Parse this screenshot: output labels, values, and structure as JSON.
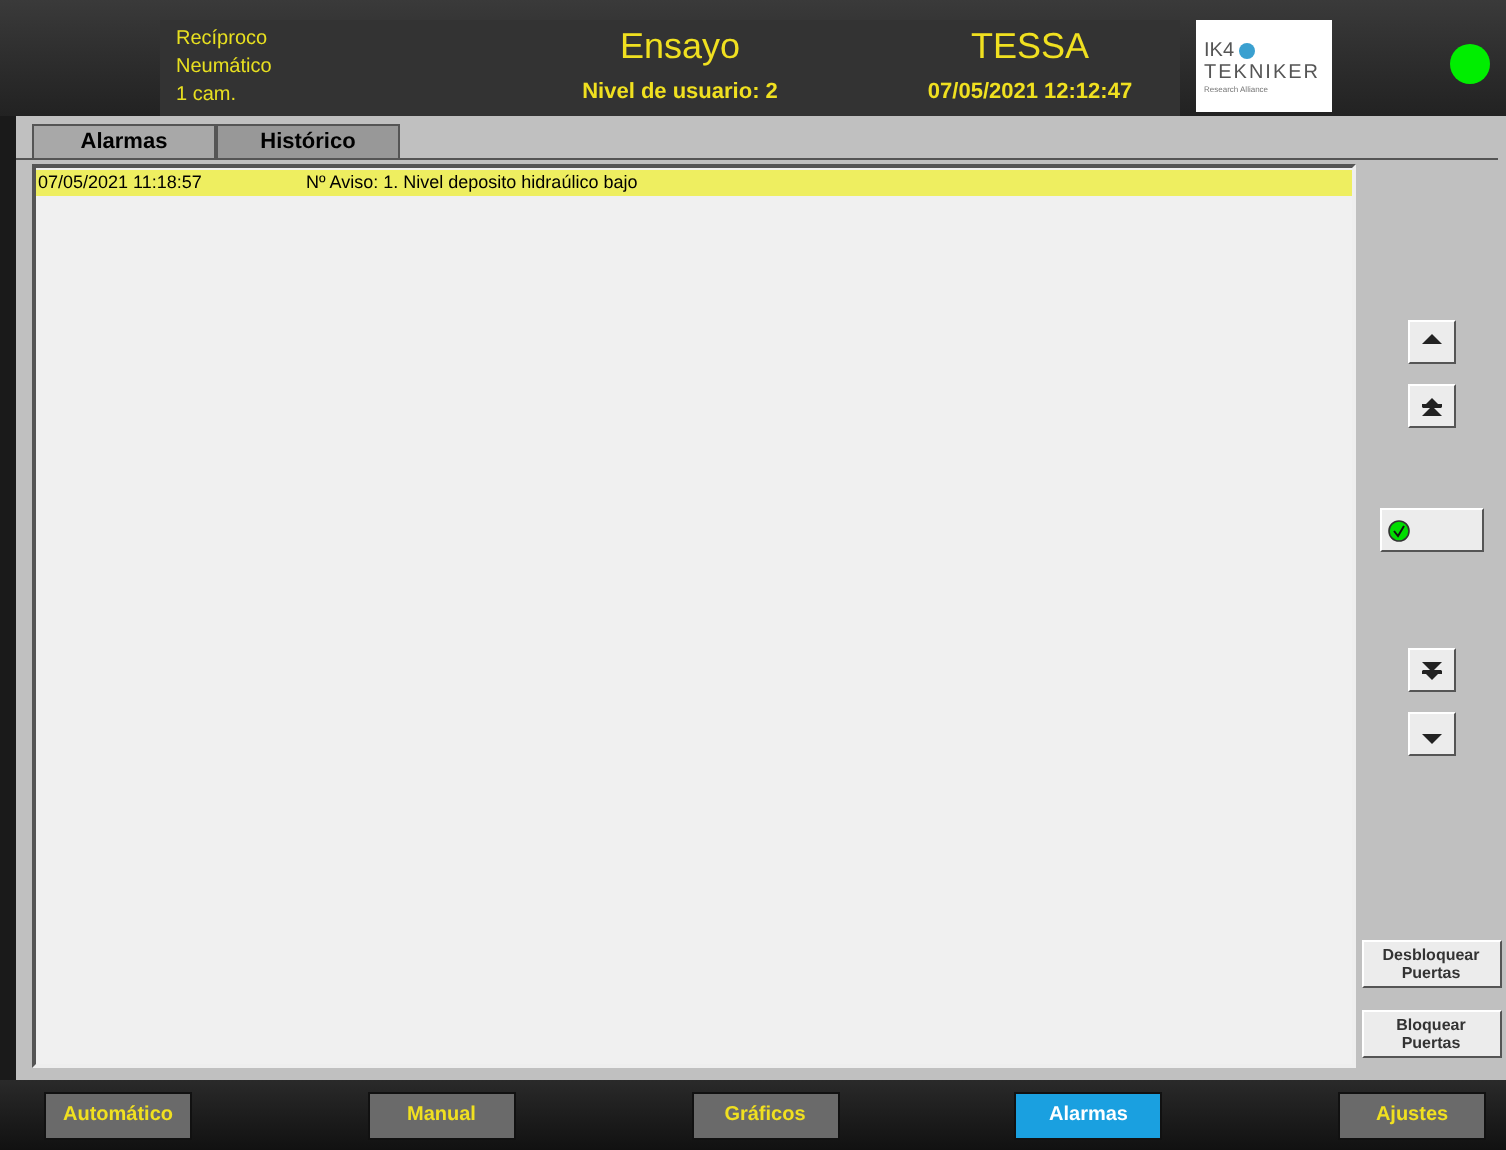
{
  "header": {
    "machine_lines": [
      "Recíproco",
      "Neumático",
      "1 cam."
    ],
    "title": "Ensayo",
    "user_level": "Nivel de usuario: 2",
    "system": "TESSA",
    "datetime": "07/05/2021 12:12:47",
    "logo_top": "IK4",
    "logo_name": "TEKNIKER",
    "logo_sub": "Research Alliance",
    "status_on": true
  },
  "tabs": [
    {
      "label": "Alarmas",
      "selected": true
    },
    {
      "label": "Histórico",
      "selected": false
    }
  ],
  "alarms": [
    {
      "time": "07/05/2021 11:18:57",
      "message": "Nº Aviso: 1. Nivel deposito hidraúlico bajo",
      "selected": true
    }
  ],
  "side_buttons": [
    {
      "label": "Desbloquear Puertas"
    },
    {
      "label": "Bloquear Puertas"
    }
  ],
  "nav": [
    {
      "label": "Automático",
      "selected": false
    },
    {
      "label": "Manual",
      "selected": false
    },
    {
      "label": "Gráficos",
      "selected": false
    },
    {
      "label": "Alarmas",
      "selected": true
    },
    {
      "label": "Ajustes",
      "selected": false
    }
  ]
}
